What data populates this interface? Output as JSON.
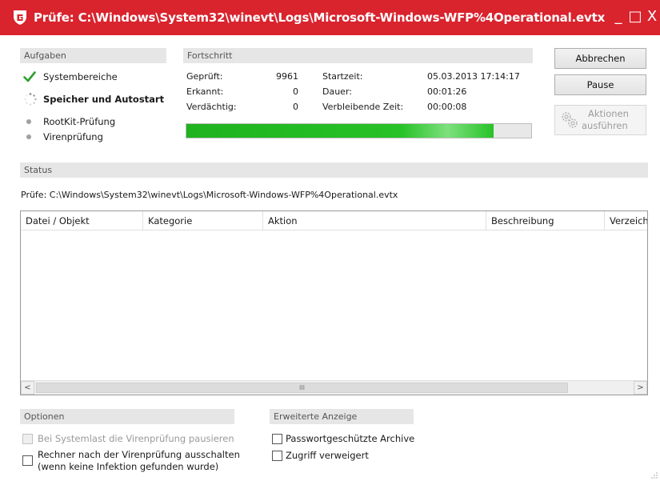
{
  "window": {
    "title": "Prüfe: C:\\Windows\\System32\\winevt\\Logs\\Microsoft-Windows-WFP%4Operational.evtx",
    "minimize": "_",
    "maximize": "□",
    "close": "X"
  },
  "tasks": {
    "header": "Aufgaben",
    "items": [
      {
        "label": "Systembereiche",
        "state": "done"
      },
      {
        "label": "Speicher und Autostart",
        "state": "running"
      },
      {
        "label": "RootKit-Prüfung",
        "state": "pending"
      },
      {
        "label": "Virenprüfung",
        "state": "pending"
      }
    ]
  },
  "progress": {
    "header": "Fortschritt",
    "geprueft_label": "Geprüft:",
    "geprueft_value": "9961",
    "erkannt_label": "Erkannt:",
    "erkannt_value": "0",
    "verdaechtig_label": "Verdächtig:",
    "verdaechtig_value": "0",
    "startzeit_label": "Startzeit:",
    "startzeit_value": "05.03.2013 17:14:17",
    "dauer_label": "Dauer:",
    "dauer_value": "00:01:26",
    "verbleibend_label": "Verbleibende Zeit:",
    "verbleibend_value": "00:00:08",
    "percent": 89
  },
  "buttons": {
    "abbrechen": "Abbrechen",
    "pause": "Pause",
    "aktionen_line1": "Aktionen",
    "aktionen_line2": "ausführen"
  },
  "status": {
    "header": "Status",
    "text": "Prüfe: C:\\Windows\\System32\\winevt\\Logs\\Microsoft-Windows-WFP%4Operational.evtx"
  },
  "table": {
    "columns": [
      "Datei / Objekt",
      "Kategorie",
      "Aktion",
      "Beschreibung",
      "Verzeichnis"
    ],
    "rows": [],
    "scroll_left": "<",
    "scroll_right": ">",
    "scroll_thumb": "III"
  },
  "options": {
    "header": "Optionen",
    "pause_label": "Bei Systemlast die Virenprüfung pausieren",
    "shutdown_line1": "Rechner nach der Virenprüfung ausschalten",
    "shutdown_line2": "(wenn keine Infektion gefunden wurde)"
  },
  "advanced": {
    "header": "Erweiterte Anzeige",
    "archives_label": "Passwortgeschützte Archive",
    "access_label": "Zugriff verweigert"
  },
  "colors": {
    "titlebar": "#d9232d",
    "progress_fill": "#27c227",
    "check": "#2e9e2e"
  }
}
